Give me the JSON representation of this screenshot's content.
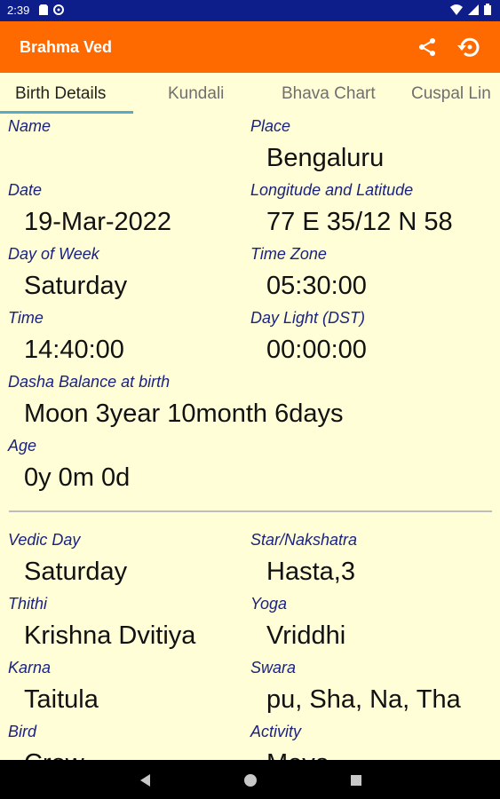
{
  "status_bar": {
    "time": "2:39"
  },
  "app_bar": {
    "title": "Brahma Ved",
    "share_icon": "share-icon",
    "history_icon": "restore-icon"
  },
  "tabs": [
    {
      "label": "Birth Details",
      "active": true
    },
    {
      "label": "Kundali",
      "active": false
    },
    {
      "label": "Bhava Chart",
      "active": false
    },
    {
      "label": "Cuspal Lin",
      "active": false
    }
  ],
  "birth": {
    "name_label": "Name",
    "name_value": "",
    "place_label": "Place",
    "place_value": "Bengaluru",
    "date_label": "Date",
    "date_value": "19-Mar-2022",
    "lonlat_label": "Longitude and Latitude",
    "lonlat_value": "77 E 35/12 N 58",
    "dow_label": "Day of Week",
    "dow_value": "Saturday",
    "tz_label": "Time Zone",
    "tz_value": "05:30:00",
    "time_label": "Time",
    "time_value": "14:40:00",
    "dst_label": "Day Light (DST)",
    "dst_value": "00:00:00",
    "dasha_label": "Dasha Balance at birth",
    "dasha_value": "Moon 3year 10month 6days",
    "age_label": "Age",
    "age_value": "0y 0m 0d"
  },
  "panchang": {
    "vedic_day_label": "Vedic Day",
    "vedic_day_value": "Saturday",
    "star_label": "Star/Nakshatra",
    "star_value": "Hasta,3",
    "thithi_label": "Thithi",
    "thithi_value": "Krishna Dvitiya",
    "yoga_label": "Yoga",
    "yoga_value": "Vriddhi",
    "karna_label": "Karna",
    "karna_value": "Taitula",
    "swara_label": "Swara",
    "swara_value": "pu, Sha, Na, Tha",
    "bird_label": "Bird",
    "bird_value": "Crow",
    "activity_label": "Activity",
    "activity_value": "Meya"
  },
  "colors": {
    "status_bar": "#0d1e8a",
    "app_bar": "#ff6a00",
    "background": "#fffed6",
    "label": "#1a237e",
    "tab_indicator": "#5aa9c9"
  }
}
